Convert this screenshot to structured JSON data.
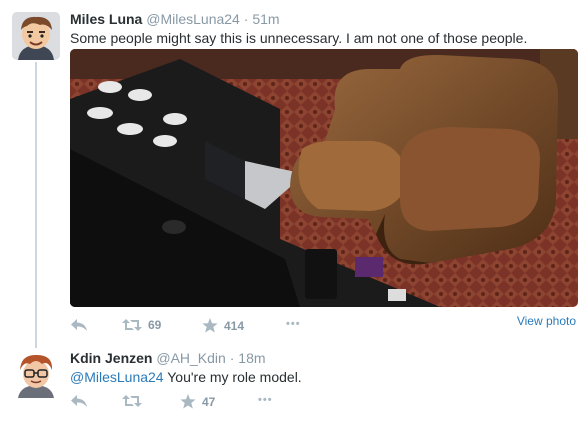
{
  "tweets": [
    {
      "fullname": "Miles Luna",
      "handle": "@MilesLuna24",
      "separator": "·",
      "time": "51m",
      "text": "Some people might say this is unnecessary. I am not one of those people.",
      "view_photo": "View photo",
      "retweets": "69",
      "favorites": "414",
      "more": "•••"
    },
    {
      "fullname": "Kdin Jenzen",
      "handle": "@AH_Kdin",
      "separator": "·",
      "time": "18m",
      "mention": "@MilesLuna24",
      "text": " You're my role model.",
      "retweets": "",
      "favorites": "47",
      "more": "•••"
    }
  ],
  "icons": {
    "reply": "reply-icon",
    "retweet": "retweet-icon",
    "favorite": "star-icon",
    "more": "more-icon"
  },
  "colors": {
    "link": "#2b7bb9",
    "muted": "#8899a6",
    "icon": "#aab8c2",
    "thread_line": "#ccd6dd"
  }
}
